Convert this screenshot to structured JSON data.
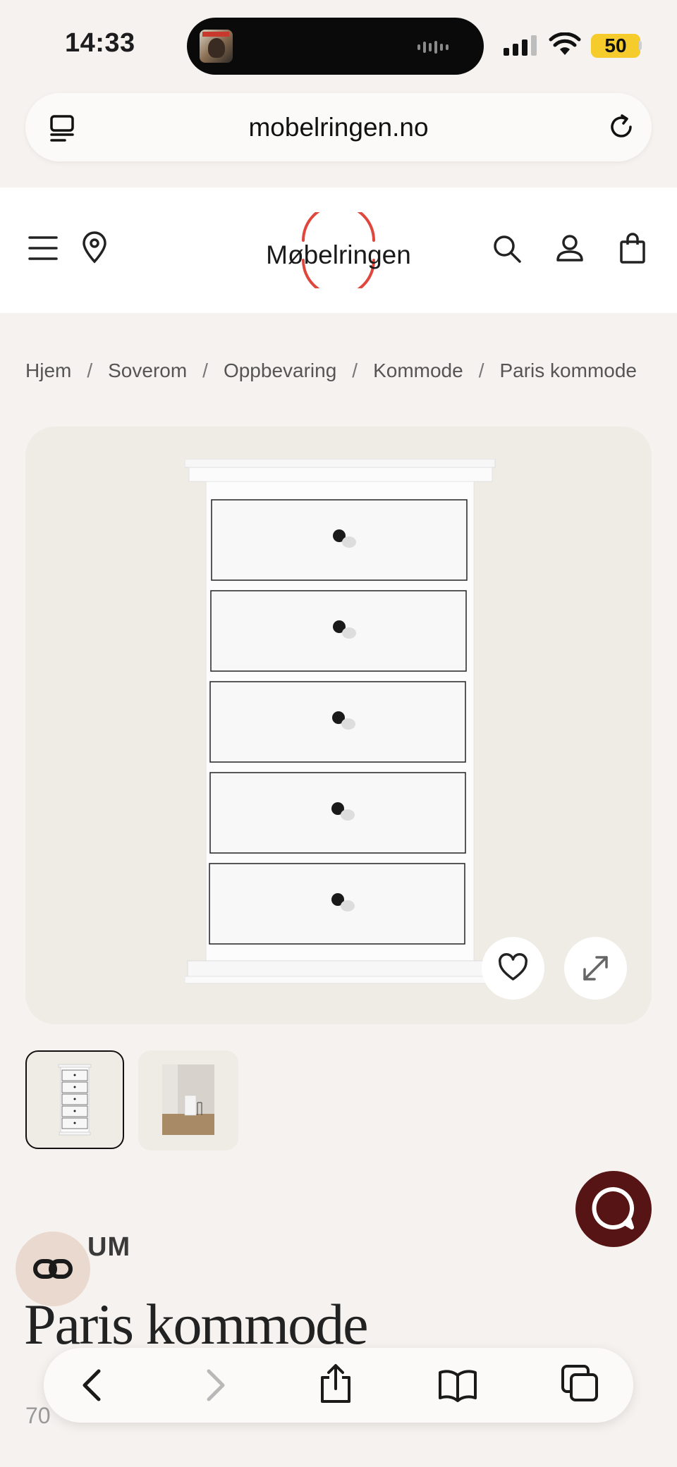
{
  "status_bar": {
    "time": "14:33",
    "battery": "50"
  },
  "url_bar": {
    "url": "mobelringen.no"
  },
  "header": {
    "logo_text": "Møbelringen"
  },
  "breadcrumb": [
    "Hjem",
    "Soverom",
    "Oppbevaring",
    "Kommode",
    "Paris kommode"
  ],
  "breadcrumb_separator": "/",
  "product": {
    "brand": "UM",
    "title": "Paris kommode",
    "sku_partial": "70"
  },
  "colors": {
    "page_bg": "#f6f2ef",
    "accent_red": "#e0463c",
    "chat_bg": "#571414",
    "ai_button_bg": "#ead9cf"
  },
  "icons": {
    "header": [
      "menu-icon",
      "location-icon",
      "search-icon",
      "account-icon",
      "cart-icon"
    ],
    "image_actions": [
      "heart-icon",
      "expand-icon"
    ],
    "toolbar": [
      "back-icon",
      "forward-icon",
      "share-icon",
      "bookmarks-icon",
      "tabs-icon"
    ]
  }
}
